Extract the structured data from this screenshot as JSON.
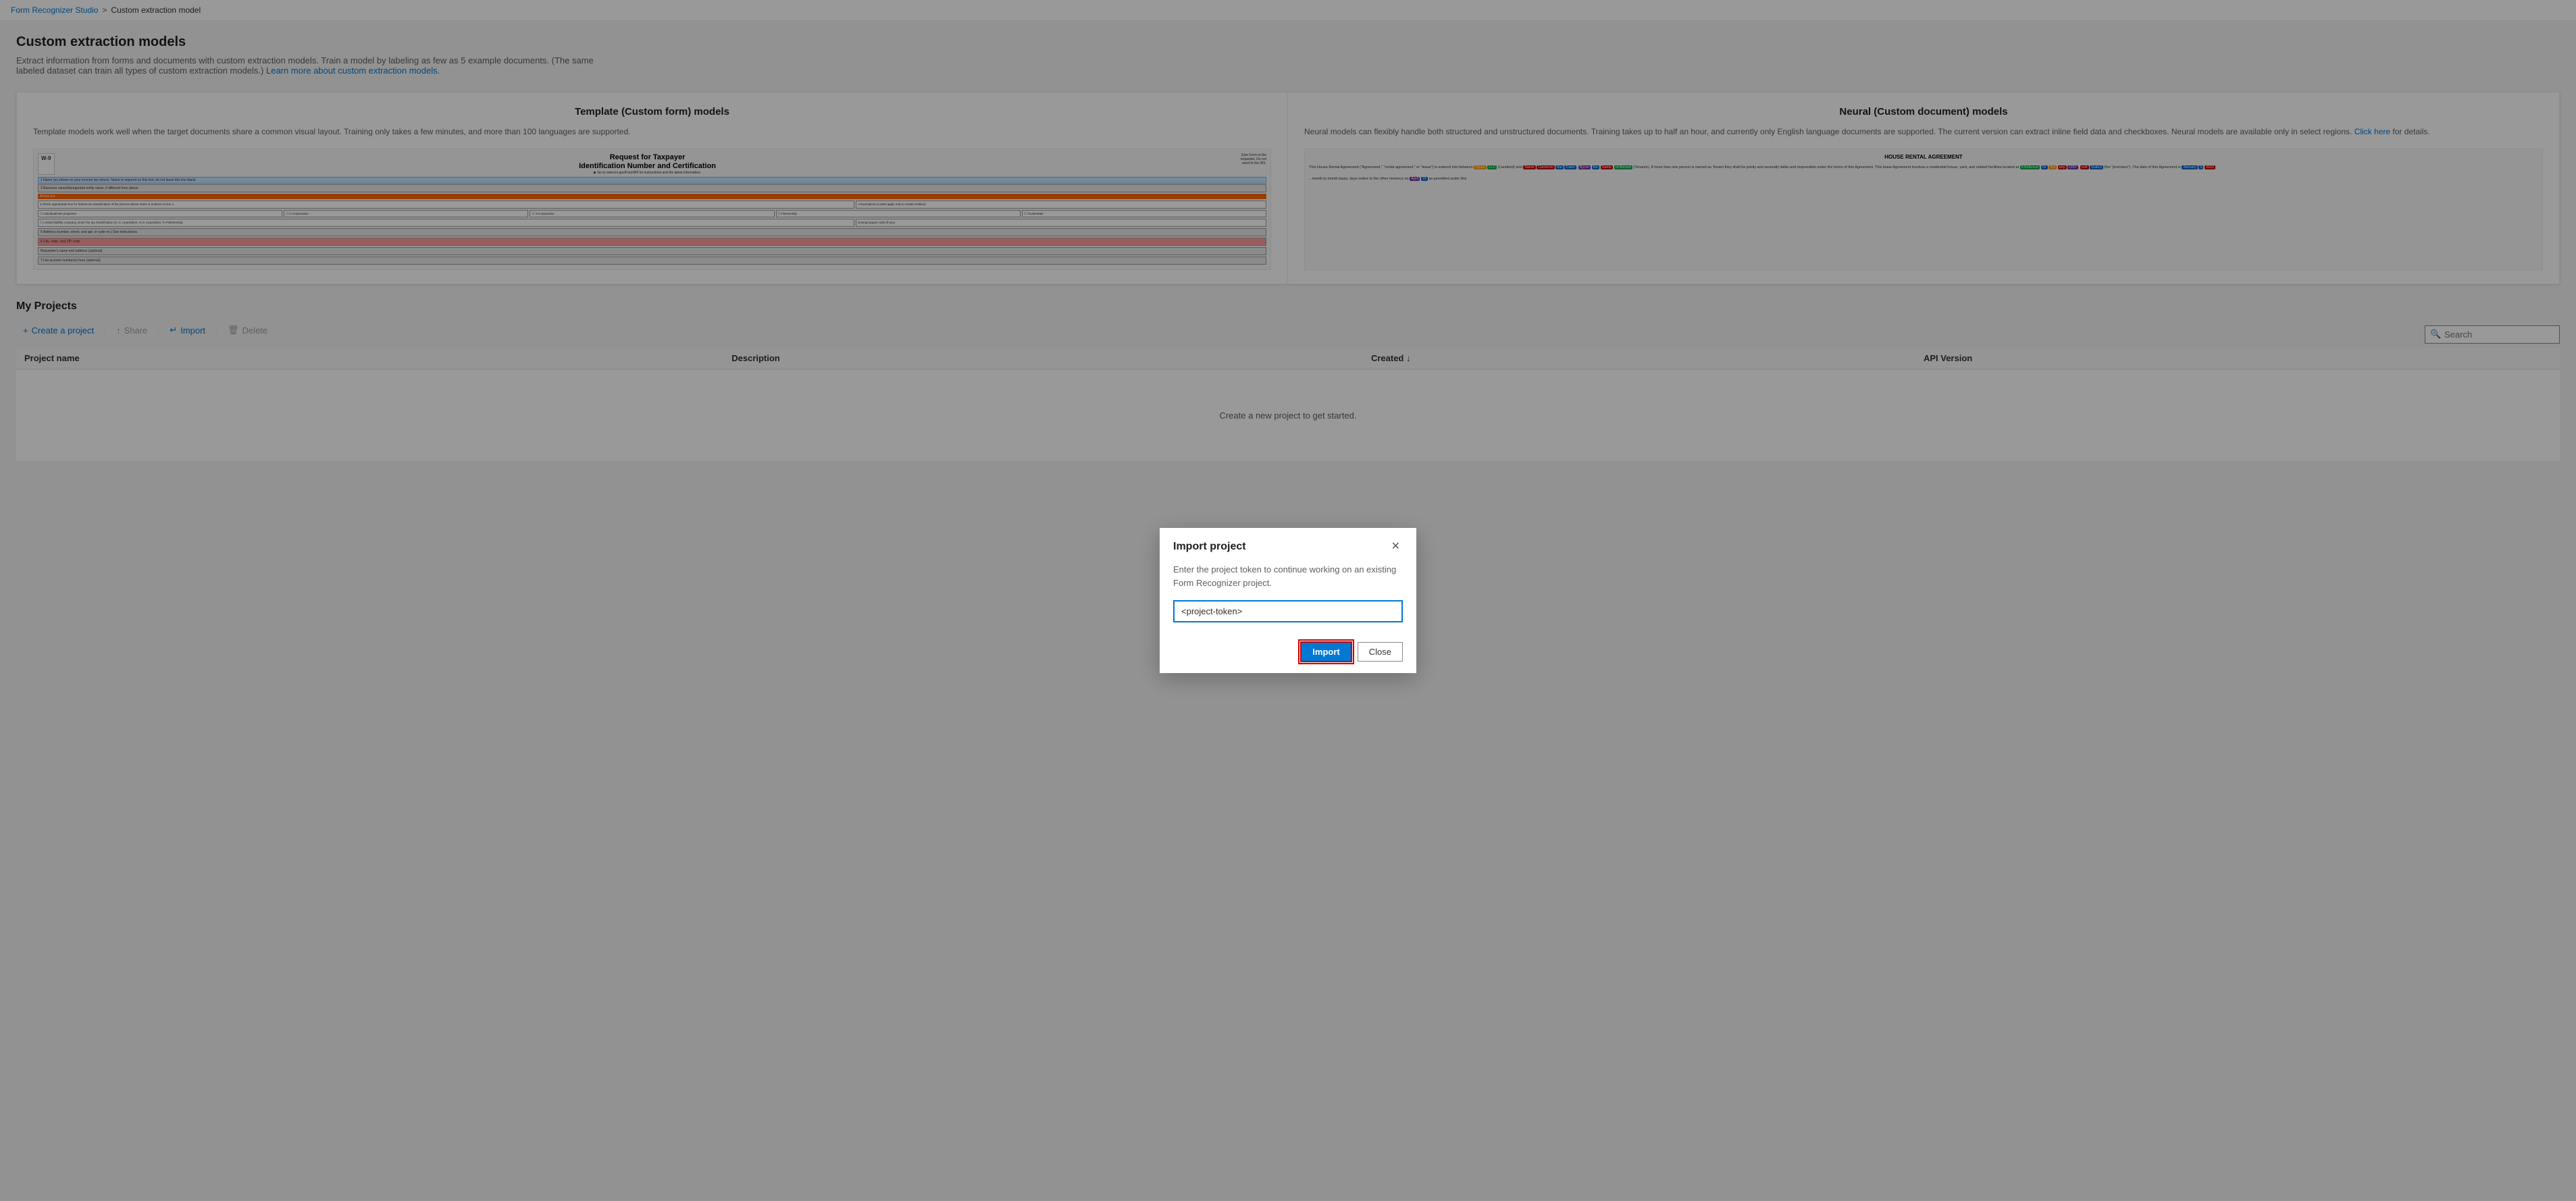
{
  "breadcrumb": {
    "home_label": "Form Recognizer Studio",
    "home_url": "#",
    "separator": ">",
    "current": "Custom extraction model"
  },
  "page": {
    "title": "Custom extraction models",
    "description": "Extract information from forms and documents with custom extraction models. Train a model by labeling as few as 5 example documents. (The same labeled dataset can train all types of custom extraction models.)",
    "learn_more_link": "Learn more about custom extraction models.",
    "learn_more_url": "#"
  },
  "model_cards": {
    "left": {
      "title": "Template (Custom form) models",
      "description": "Template models work well when the target documents share a common visual layout. Training only takes a few minutes, and more than 100 languages are supported.",
      "preview_type": "w9"
    },
    "right": {
      "title": "Neural (Custom document) models",
      "description": "Neural models can flexibly handle both structured and unstructured documents. Training takes up to half an hour, and currently only English language documents are supported. The current version can extract inline field data and checkboxes. Neural models are available only in select regions.",
      "click_here_text": "Click here",
      "click_here_url": "#",
      "description_suffix": " for details.",
      "preview_type": "rental"
    }
  },
  "my_projects": {
    "title": "My Projects",
    "toolbar": {
      "create_label": "Create a project",
      "share_label": "Share",
      "import_label": "Import",
      "delete_label": "Delete"
    },
    "search_placeholder": "Search",
    "table": {
      "columns": [
        {
          "key": "project_name",
          "label": "Project name"
        },
        {
          "key": "description",
          "label": "Description"
        },
        {
          "key": "created",
          "label": "Created ↓"
        },
        {
          "key": "api_version",
          "label": "API Version"
        }
      ],
      "rows": [],
      "empty_message": "Create a new project to get started."
    }
  },
  "modal": {
    "title": "Import project",
    "description": "Enter the project token to continue working on an existing Form Recognizer project.",
    "input_placeholder": "<project-token>",
    "input_value": "<project-token>",
    "import_label": "Import",
    "close_label": "Close"
  },
  "colors": {
    "primary": "#0078d4",
    "danger": "#cc0000",
    "text_primary": "#201f1e",
    "text_secondary": "#605e5c",
    "border": "#edebe9",
    "background": "#f3f3f3"
  }
}
